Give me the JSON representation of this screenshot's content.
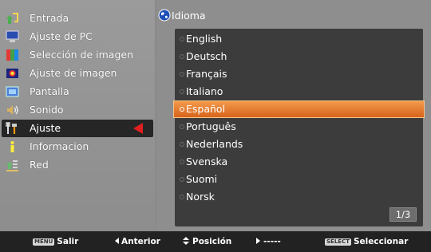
{
  "sidebar": {
    "items": [
      {
        "label": "Entrada",
        "icon": "input-icon"
      },
      {
        "label": "Ajuste de PC",
        "icon": "pc-adjust-icon"
      },
      {
        "label": "Selección de imagen",
        "icon": "image-select-icon"
      },
      {
        "label": "Ajuste de imagen",
        "icon": "image-adjust-icon"
      },
      {
        "label": "Pantalla",
        "icon": "screen-icon"
      },
      {
        "label": "Sonido",
        "icon": "sound-icon"
      },
      {
        "label": "Ajuste",
        "icon": "setting-icon",
        "selected": true
      },
      {
        "label": "Informacion",
        "icon": "information-icon"
      },
      {
        "label": "Red",
        "icon": "network-icon"
      }
    ]
  },
  "language_menu": {
    "title": "Idioma",
    "items": [
      {
        "label": "English"
      },
      {
        "label": "Deutsch"
      },
      {
        "label": "Français"
      },
      {
        "label": "Italiano"
      },
      {
        "label": "Español",
        "selected": true
      },
      {
        "label": "Português"
      },
      {
        "label": "Nederlands"
      },
      {
        "label": "Svenska"
      },
      {
        "label": "Suomi"
      },
      {
        "label": "Norsk"
      }
    ],
    "page_indicator": "1/3"
  },
  "footer": {
    "menu_key": "MENU",
    "exit_label": "Salir",
    "prev_label": "Anterior",
    "position_label": "Posición",
    "next_label": "-----",
    "select_key": "SELECT",
    "select_label": "Seleccionar"
  },
  "colors": {
    "highlight": "#e77a2c",
    "selection_arrow": "#e02020",
    "list_background": "#3c3c3c"
  }
}
